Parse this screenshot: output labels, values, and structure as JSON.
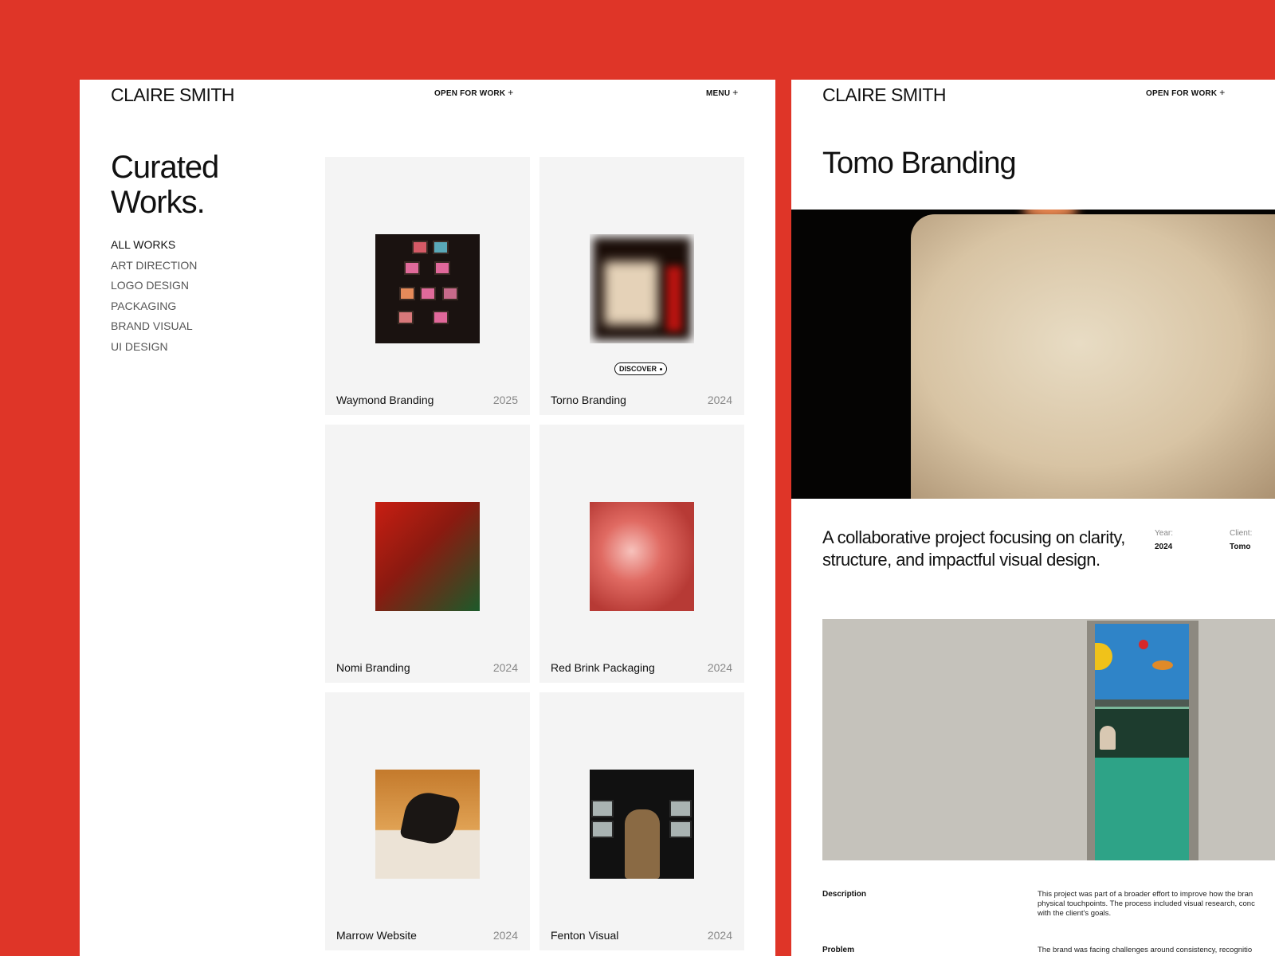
{
  "left": {
    "logo": "CLAIRE SMITH",
    "nav_open": "OPEN FOR WORK",
    "nav_menu": "MENU",
    "plus": "+",
    "heading_line1": "Curated",
    "heading_line2": "Works.",
    "filters": [
      "ALL WORKS",
      "ART DIRECTION",
      "LOGO DESIGN",
      "PACKAGING",
      "BRAND VISUAL",
      "UI DESIGN"
    ],
    "active_filter": "ALL WORKS",
    "discover_label": "DISCOVER",
    "projects": [
      {
        "name": "Waymond Branding",
        "year": "2025"
      },
      {
        "name": "Torno Branding",
        "year": "2024"
      },
      {
        "name": "Nomi Branding",
        "year": "2024"
      },
      {
        "name": "Red Brink Packaging",
        "year": "2024"
      },
      {
        "name": "Marrow Website",
        "year": "2024"
      },
      {
        "name": "Fenton Visual",
        "year": "2024"
      }
    ]
  },
  "right": {
    "logo": "CLAIRE SMITH",
    "nav_open": "OPEN FOR WORK",
    "plus": "+",
    "title": "Tomo Branding",
    "lead": "A collaborative project focusing on clarity, structure, and impactful visual design.",
    "year_label": "Year:",
    "year_value": "2024",
    "client_label": "Client:",
    "client_value": "Tomo",
    "description_label": "Description",
    "description_lines": [
      "This project was part of a broader effort to improve how the bran",
      "physical touchpoints. The process included visual research, conc",
      "with the client's goals."
    ],
    "problem_label": "Problem",
    "problem_line": "The brand was facing challenges around consistency, recognitio"
  },
  "colors": {
    "background": "#df3528",
    "card": "#f4f4f4",
    "panel": "#ffffff"
  }
}
